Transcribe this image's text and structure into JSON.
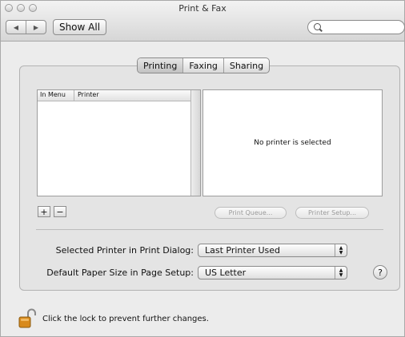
{
  "window": {
    "title": "Print & Fax"
  },
  "toolbar": {
    "show_all_label": "Show All",
    "nav_back_glyph": "◀",
    "nav_forward_glyph": "▶",
    "search_placeholder": ""
  },
  "tabs": [
    {
      "label": "Printing",
      "selected": true
    },
    {
      "label": "Faxing",
      "selected": false
    },
    {
      "label": "Sharing",
      "selected": false
    }
  ],
  "printer_list": {
    "columns": [
      "In Menu",
      "Printer"
    ],
    "rows": []
  },
  "detail": {
    "empty_message": "No printer is selected"
  },
  "list_buttons": {
    "add": "+",
    "remove": "−"
  },
  "action_buttons": {
    "print_queue": "Print Queue...",
    "printer_setup": "Printer Setup..."
  },
  "settings": {
    "selected_printer_label": "Selected Printer in Print Dialog:",
    "selected_printer_value": "Last Printer Used",
    "paper_size_label": "Default Paper Size in Page Setup:",
    "paper_size_value": "US Letter"
  },
  "help": {
    "glyph": "?"
  },
  "lock": {
    "message": "Click the lock to prevent further changes.",
    "icon": "unlocked-padlock-icon",
    "color": "#d88a1c"
  }
}
